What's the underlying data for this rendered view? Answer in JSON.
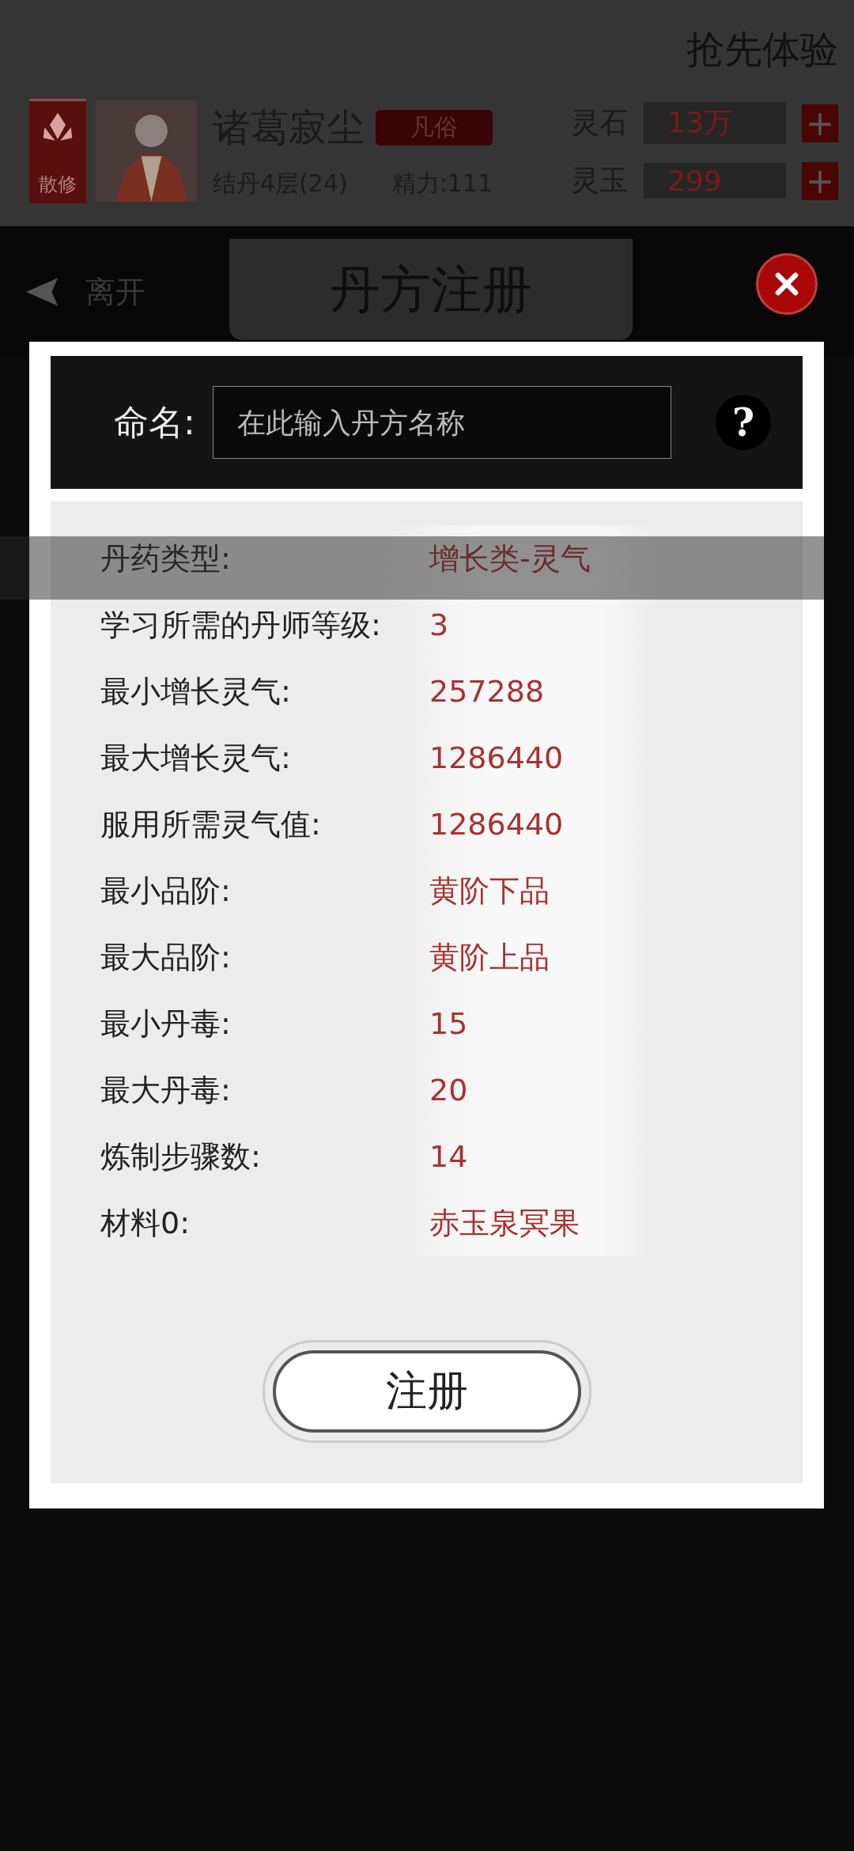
{
  "top_bar": {
    "title": "抢先体验"
  },
  "player": {
    "sect_badge": "散修",
    "name": "诸葛寂尘",
    "rank_tag": "凡俗",
    "realm": "结丹4层(24)",
    "energy": "精力:111",
    "currencies": [
      {
        "label": "灵石",
        "amount": "13万",
        "add": "+"
      },
      {
        "label": "灵玉",
        "amount": "299",
        "add": "+"
      }
    ]
  },
  "header": {
    "back_label": "离开",
    "title": "丹方注册"
  },
  "dialog": {
    "name_label": "命名:",
    "name_placeholder": "在此输入丹方名称",
    "help": "?",
    "rows": [
      {
        "label": "丹药类型:",
        "value": "增长类-灵气"
      },
      {
        "label": "学习所需的丹师等级:",
        "value": "3"
      },
      {
        "label": "最小增长灵气:",
        "value": "257288"
      },
      {
        "label": "最大增长灵气:",
        "value": "1286440"
      },
      {
        "label": "服用所需灵气值:",
        "value": "1286440"
      },
      {
        "label": "最小品阶:",
        "value": "黄阶下品"
      },
      {
        "label": "最大品阶:",
        "value": "黄阶上品"
      },
      {
        "label": "最小丹毒:",
        "value": "15"
      },
      {
        "label": "最大丹毒:",
        "value": "20"
      },
      {
        "label": "炼制步骤数:",
        "value": "14"
      },
      {
        "label": "材料0:",
        "value": "赤玉泉冥果"
      }
    ],
    "register_button": "注册"
  }
}
